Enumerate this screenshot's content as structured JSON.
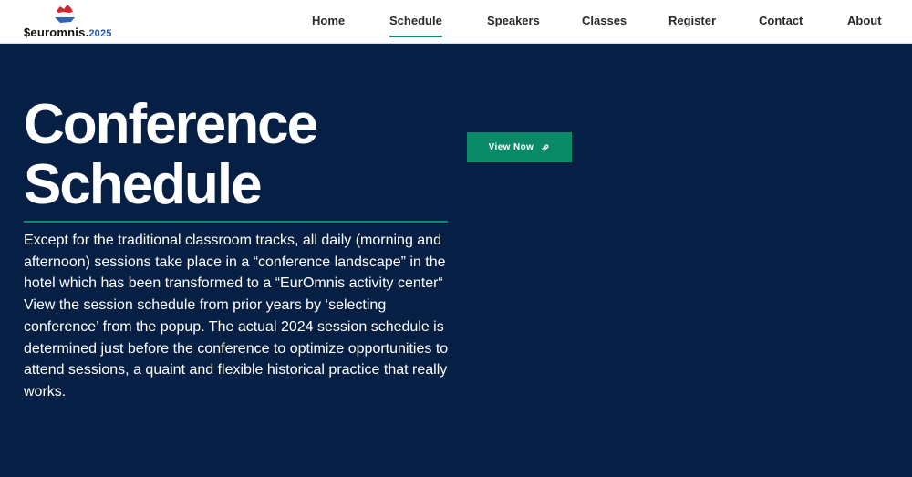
{
  "header": {
    "logo": {
      "name": "$euromnis.",
      "year": "2025"
    },
    "nav": [
      {
        "label": "Home",
        "active": false
      },
      {
        "label": "Schedule",
        "active": true
      },
      {
        "label": "Speakers",
        "active": false
      },
      {
        "label": "Classes",
        "active": false
      },
      {
        "label": "Register",
        "active": false
      },
      {
        "label": "Contact",
        "active": false
      },
      {
        "label": "About",
        "active": false
      }
    ]
  },
  "hero": {
    "title_line1": "Conference",
    "title_line2": "Schedule",
    "paragraph1": "Except for the traditional classroom tracks, all daily (morning and afternoon) sessions take place in a “conference landscape” in the hotel which has been transformed to a “EurOmnis activity center“",
    "paragraph2": "View the session schedule from prior years by ‘selecting conference’ from the popup. The actual 2024 session schedule is determined just before the conference to optimize opportunities to attend sessions, a quaint and flexible historical practice that really works.",
    "button_label": "View Now",
    "button_icon": "link-icon"
  },
  "colors": {
    "background": "#061f44",
    "accent": "#0e8a6a",
    "button": "#0a8a66",
    "header": "#ffffff"
  }
}
